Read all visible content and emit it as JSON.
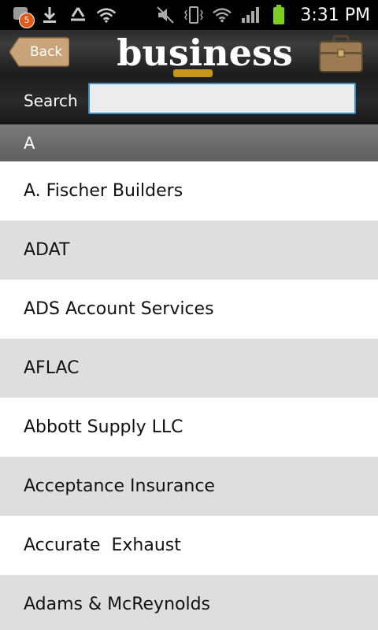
{
  "status_bar": {
    "notification_count": "5",
    "time": "3:31 PM",
    "left_icons": [
      "notification-icon",
      "download-icon",
      "recycle-icon",
      "wifi-icon"
    ],
    "right_icons": [
      "mute-icon",
      "vibrate-icon",
      "wifi-signal-icon",
      "cell-signal-icon",
      "battery-icon"
    ]
  },
  "header": {
    "back_label": "Back",
    "brand": "business",
    "icon": "briefcase-icon"
  },
  "search": {
    "label": "Search",
    "value": "",
    "placeholder": ""
  },
  "section": {
    "letter": "A"
  },
  "list": {
    "items": [
      "A. Fischer Builders",
      "ADAT",
      "ADS Account Services",
      "AFLAC",
      "Abbott Supply LLC",
      "Acceptance Insurance",
      "Accurate  Exhaust",
      "Adams & McReynolds"
    ]
  },
  "colors": {
    "accent_border": "#3a8dc4",
    "back_button": "#c9a37a",
    "alt_row": "#dedede",
    "notification_badge": "#e0581a"
  }
}
